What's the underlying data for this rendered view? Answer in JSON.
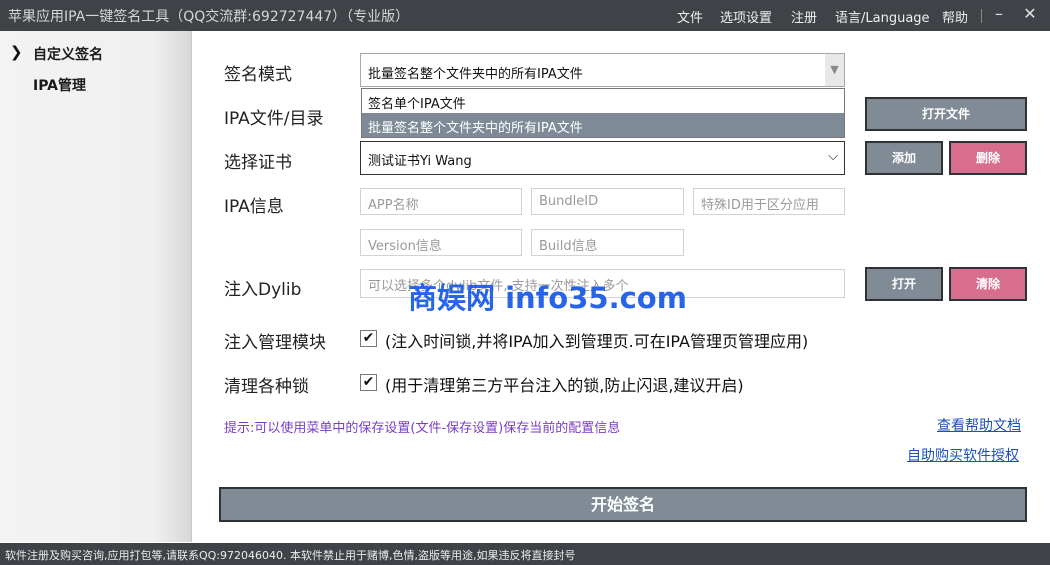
{
  "window": {
    "title": "苹果应用IPA一键签名工具（QQ交流群:692727447）（专业版）",
    "menu": [
      "文件",
      "选项设置",
      "注册",
      "语言/Language",
      "帮助"
    ],
    "minimize_glyph": "–",
    "close_glyph": "✕"
  },
  "sidebar": {
    "items": [
      {
        "label": "自定义签名",
        "active": true
      },
      {
        "label": "IPA管理",
        "active": false
      }
    ]
  },
  "form": {
    "sign_mode": {
      "label": "签名模式",
      "value": "批量签名整个文件夹中的所有IPA文件",
      "options": [
        "签名单个IPA文件",
        "批量签名整个文件夹中的所有IPA文件"
      ],
      "selected_index": 1
    },
    "ipa_path": {
      "label": "IPA文件/目录",
      "open_button": "打开文件"
    },
    "certificate": {
      "label": "选择证书",
      "value": "测试证书Yi Wang",
      "add_button": "添加",
      "delete_button": "删除"
    },
    "ipa_info": {
      "label": "IPA信息",
      "app_name_placeholder": "APP名称",
      "bundle_id_placeholder": "BundleID",
      "special_id_placeholder": "特殊ID用于区分应用",
      "version_placeholder": "Version信息",
      "build_placeholder": "Build信息"
    },
    "dylib": {
      "label": "注入Dylib",
      "placeholder": "可以选择多个dylib文件, 支持一次性注入多个",
      "open_button": "打开",
      "clear_button": "清除"
    },
    "manage_module": {
      "label": "注入管理模块",
      "checked": true,
      "description": "(注入时间锁,并将IPA加入到管理页.可在IPA管理页管理应用)"
    },
    "clean_locks": {
      "label": "清理各种锁",
      "checked": true,
      "description": "(用于清理第三方平台注入的锁,防止闪退,建议开启)"
    },
    "tip": "提示:可以使用菜单中的保存设置(文件-保存设置)保存当前的配置信息",
    "help_link": "查看帮助文档",
    "buy_link": "自助购买软件授权",
    "start_button": "开始签名"
  },
  "watermark": "商娱网 info35.com",
  "statusbar": "软件注册及购买咨询,应用打包等,请联系QQ:972046040.  本软件禁止用于赌博,色情,盗版等用途,如果违反将直接封号",
  "colors": {
    "titlebar": "#3f4247",
    "button_gray": "#808b96",
    "button_pink": "#d86e8d",
    "tip_text": "#7a3ec8",
    "link": "#1f4fb8",
    "watermark": "#1c5ce6"
  }
}
